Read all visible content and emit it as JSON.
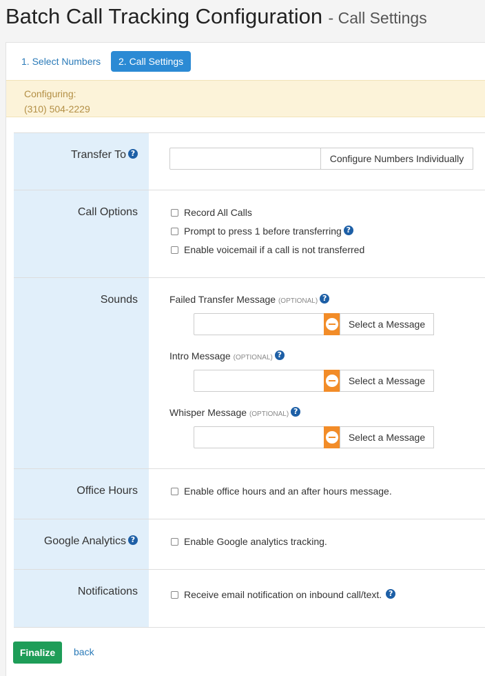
{
  "header": {
    "title": "Batch Call Tracking Configuration",
    "subtitle": "- Call Settings"
  },
  "tabs": [
    {
      "label": "1. Select Numbers",
      "active": false
    },
    {
      "label": "2. Call Settings",
      "active": true
    }
  ],
  "configuring": {
    "label": "Configuring:",
    "number": "(310) 504-2229"
  },
  "transfer_to": {
    "label": "Transfer To",
    "value": "",
    "button": "Configure Numbers Individually"
  },
  "call_options": {
    "label": "Call Options",
    "options": [
      "Record All Calls",
      "Prompt to press 1 before transferring",
      "Enable voicemail if a call is not transferred"
    ]
  },
  "sounds": {
    "label": "Sounds",
    "optional_tag": "(OPTIONAL)",
    "button": "Select a Message",
    "messages": [
      "Failed Transfer Message",
      "Intro Message",
      "Whisper Message"
    ]
  },
  "office_hours": {
    "label": "Office Hours",
    "option": "Enable office hours and an after hours message."
  },
  "google_analytics": {
    "label": "Google Analytics",
    "option": "Enable Google analytics tracking."
  },
  "notifications": {
    "label": "Notifications",
    "option": "Receive email notification on inbound call/text."
  },
  "footer": {
    "finalize": "Finalize",
    "back": "back"
  },
  "colors": {
    "accent": "#2b8ad4",
    "label_bg": "#e1effa",
    "orange": "#f28c28",
    "finalize": "#1e9d58",
    "config_bg": "#fcf3d9"
  },
  "icons": {
    "help": "help-icon",
    "remove": "minus-circle-icon"
  }
}
